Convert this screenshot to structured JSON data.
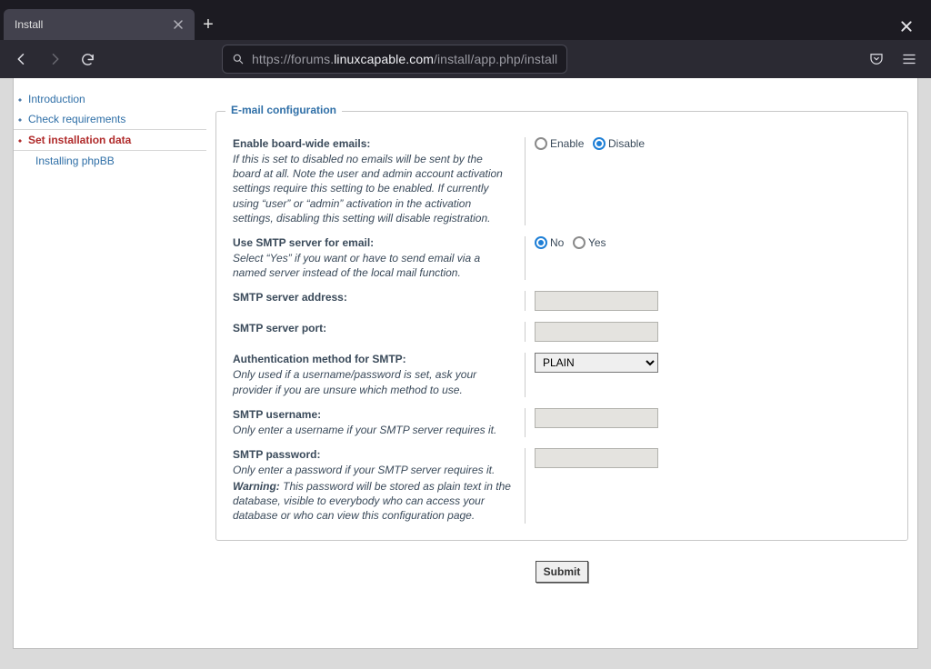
{
  "browser": {
    "tab_title": "Install",
    "url_pre": "https://forums.",
    "url_host": "linuxcapable.com",
    "url_path": "/install/app.php/install"
  },
  "sidebar": {
    "items": [
      {
        "label": "Introduction"
      },
      {
        "label": "Check requirements"
      },
      {
        "label": "Set installation data"
      },
      {
        "label": "Installing phpBB"
      }
    ]
  },
  "form": {
    "legend": "E-mail configuration",
    "enable_emails": {
      "label": "Enable board-wide emails:",
      "help": "If this is set to disabled no emails will be sent by the board at all. Note the user and admin account activation settings require this setting to be enabled. If currently using “user” or “admin” activation in the activation settings, disabling this setting will disable registration.",
      "opt_enable": "Enable",
      "opt_disable": "Disable",
      "value": "disable"
    },
    "use_smtp": {
      "label": "Use SMTP server for email:",
      "help": "Select “Yes” if you want or have to send email via a named server instead of the local mail function.",
      "opt_no": "No",
      "opt_yes": "Yes",
      "value": "no"
    },
    "smtp_host": {
      "label": "SMTP server address:",
      "value": ""
    },
    "smtp_port": {
      "label": "SMTP server port:",
      "value": ""
    },
    "smtp_auth": {
      "label": "Authentication method for SMTP:",
      "help": "Only used if a username/password is set, ask your provider if you are unsure which method to use.",
      "value": "PLAIN"
    },
    "smtp_user": {
      "label": "SMTP username:",
      "help": "Only enter a username if your SMTP server requires it.",
      "value": ""
    },
    "smtp_pass": {
      "label": "SMTP password:",
      "help": "Only enter a password if your SMTP server requires it.",
      "warn_label": "Warning:",
      "warn": "This password will be stored as plain text in the database, visible to everybody who can access your database or who can view this configuration page.",
      "value": ""
    },
    "submit": "Submit"
  }
}
